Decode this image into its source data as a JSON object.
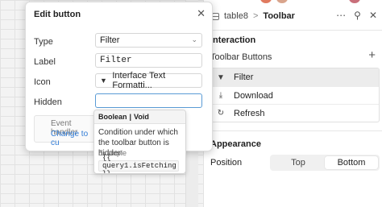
{
  "modal": {
    "title": "Edit button",
    "type_label": "Type",
    "type_value": "Filter",
    "label_label": "Label",
    "label_value": "Filter",
    "icon_label": "Icon",
    "icon_value": "Interface Text Formatti...",
    "hidden_label": "Hidden",
    "hidden_value": "",
    "event_title": "Event handler",
    "event_link": "Change to cu"
  },
  "tooltip": {
    "type_bool": "Boolean",
    "type_sep": "|",
    "type_void": "Void",
    "description": "Condition under which the toolbar button is hidden",
    "example_label": "Example",
    "example_code": "{{ query1.isFetching }}"
  },
  "inspector": {
    "crumb_parent": "table8",
    "crumb_sep": ">",
    "crumb_current": "Toolbar",
    "interaction_title": "Interaction",
    "toolbar_buttons_title": "Toolbar Buttons",
    "buttons": [
      {
        "label": "Filter",
        "icon": "funnel-icon"
      },
      {
        "label": "Download",
        "icon": "download-icon"
      },
      {
        "label": "Refresh",
        "icon": "refresh-icon"
      }
    ],
    "appearance_title": "Appearance",
    "position_label": "Position",
    "position_options": [
      "Top",
      "Bottom"
    ],
    "position_selected": "Bottom"
  },
  "colors": {
    "accent_focus": "#5a9bd5",
    "link": "#2f7bd6"
  }
}
